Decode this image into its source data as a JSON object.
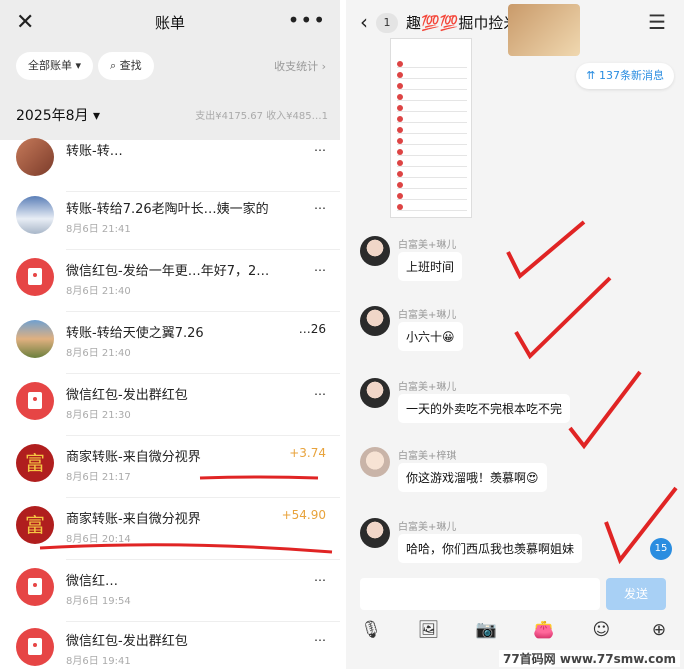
{
  "left": {
    "title": "账单",
    "filter_all": "全部账单 ▾",
    "search": "查找",
    "stats_link": "收支统计 ›",
    "month": "2025年8月 ▾",
    "summary": "支出¥4175.67  收入¥485…1",
    "transactions": [
      {
        "title": "转账-转…",
        "date": "",
        "amount": "…",
        "avatar": "photo1"
      },
      {
        "title": "转账-转给7.26老陶叶长…姨一家的",
        "date": "8月6日 21:41",
        "amount": "…",
        "avatar": "photo2"
      },
      {
        "title": "微信红包-发给一年更…年好7，2…",
        "date": "8月6日 21:40",
        "amount": "…",
        "avatar": "red"
      },
      {
        "title": "转账-转给天使之翼7.26",
        "date": "8月6日 21:40",
        "amount": "…26",
        "avatar": "photo3"
      },
      {
        "title": "微信红包-发出群红包",
        "date": "8月6日 21:30",
        "amount": "…",
        "avatar": "red"
      },
      {
        "title": "商家转账-来自微分视界",
        "date": "8月6日 21:17",
        "amount": "+3.74",
        "avatar": "fu"
      },
      {
        "title": "商家转账-来自微分视界",
        "date": "8月6日 20:14",
        "amount": "+54.90",
        "avatar": "fu"
      },
      {
        "title": "微信红…",
        "date": "8月6日 19:54",
        "amount": "…",
        "avatar": "red"
      },
      {
        "title": "微信红包-发出群红包",
        "date": "8月6日 19:41",
        "amount": "…",
        "avatar": "red"
      }
    ],
    "fu_char": "富"
  },
  "right": {
    "unread_count": "1",
    "title": "趣💯💯掘巾捡米🐤",
    "new_messages": "137条新消息",
    "messages": [
      {
        "name": "白富美+琳儿",
        "text": "上班时间",
        "avatar": "woman"
      },
      {
        "name": "白富美+琳儿",
        "text": "小六十😀",
        "avatar": "woman"
      },
      {
        "name": "白富美+琳儿",
        "text": "一天的外卖吃不完根本吃不完",
        "avatar": "woman"
      },
      {
        "name": "白富美+梓琪",
        "text": "你这游戏溜哦！羡慕啊😍",
        "avatar": "kid"
      },
      {
        "name": "白富美+琳儿",
        "text": "哈哈，你们西瓜我也羡慕啊姐妹",
        "avatar": "woman"
      }
    ],
    "send": "发送",
    "badge": "15",
    "icons": [
      "mic-icon",
      "image-icon",
      "camera-icon",
      "wallet-icon",
      "emoji-icon",
      "plus-icon"
    ]
  },
  "watermark": "77首码网 www.77smw.com",
  "colors": {
    "annotation": "#e02424",
    "accent": "#2a8de0",
    "income": "#e8a33c"
  }
}
